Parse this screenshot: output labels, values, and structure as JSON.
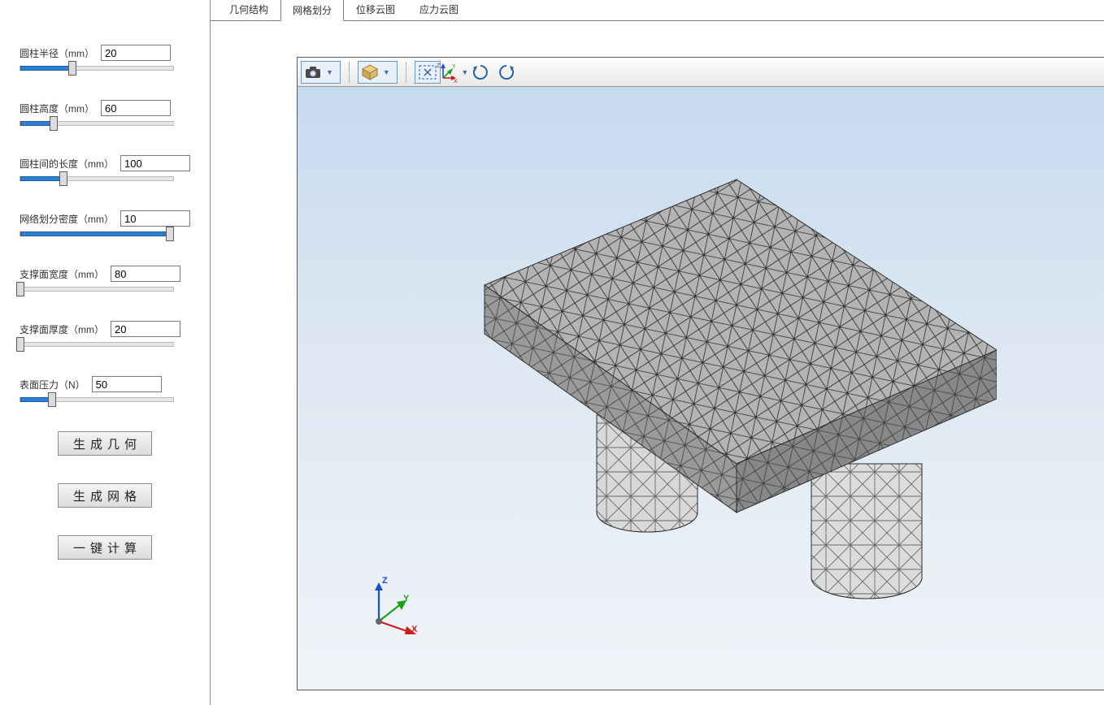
{
  "sidebar": {
    "params": [
      {
        "label": "圆柱半径（mm）",
        "value": "20",
        "fillPct": 34
      },
      {
        "label": "圆柱高度（mm）",
        "value": "60",
        "fillPct": 22
      },
      {
        "label": "圆柱间的长度（mm）",
        "value": "100",
        "fillPct": 28
      },
      {
        "label": "网络划分密度（mm）",
        "value": "10",
        "fillPct": 98
      },
      {
        "label": "支撑面宽度（mm）",
        "value": "80",
        "fillPct": 0
      },
      {
        "label": "支撑面厚度（mm）",
        "value": "20",
        "fillPct": 0
      },
      {
        "label": "表面压力（N）",
        "value": "50",
        "fillPct": 21
      }
    ],
    "buttons": {
      "genGeom": "生成几何",
      "genMesh": "生成网格",
      "compute": "一键计算"
    }
  },
  "tabs": {
    "items": [
      "几何结构",
      "网格划分",
      "位移云图",
      "应力云图"
    ],
    "active": 1
  },
  "toolbar": {
    "camera": "camera-icon",
    "cube": "cube-view-icon",
    "fit": "fit-view-icon",
    "axes": "axes-triad-icon",
    "rotcw": "rotate-cw-icon",
    "rotccw": "rotate-ccw-icon"
  },
  "gizmo": {
    "x": "X",
    "y": "Y",
    "z": "Z"
  }
}
